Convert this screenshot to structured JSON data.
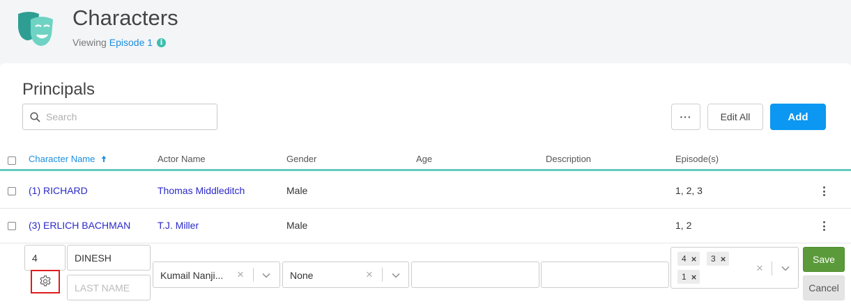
{
  "header": {
    "title": "Characters",
    "viewing_label": "Viewing",
    "episode_link": "Episode 1"
  },
  "section": {
    "title": "Principals"
  },
  "search": {
    "placeholder": "Search",
    "value": ""
  },
  "toolbar": {
    "more_label": "···",
    "edit_all_label": "Edit All",
    "add_label": "Add"
  },
  "table": {
    "columns": [
      {
        "label": "Character Name",
        "sort": "ascending"
      },
      {
        "label": "Actor Name"
      },
      {
        "label": "Gender"
      },
      {
        "label": "Age"
      },
      {
        "label": "Description"
      },
      {
        "label": "Episode(s)"
      }
    ],
    "rows": [
      {
        "character": "(1) RICHARD",
        "actor": "Thomas Middleditch",
        "gender": "Male",
        "age": "",
        "description": "",
        "episodes": "1, 2, 3"
      },
      {
        "character": "(3) ERLICH BACHMAN",
        "actor": "T.J. Miller",
        "gender": "Male",
        "age": "",
        "description": "",
        "episodes": "1, 2"
      }
    ]
  },
  "edit_row": {
    "number_value": "4",
    "first_name_value": "DINESH",
    "last_name_placeholder": "LAST NAME",
    "actor_value": "Kumail Nanji...",
    "gender_value": "None",
    "age_value": "",
    "description_value": "",
    "episode_tags": [
      "4",
      "3",
      "1"
    ],
    "tag_remove_glyph": "×",
    "clear_glyph": "×",
    "save_label": "Save",
    "cancel_label": "Cancel"
  },
  "colors": {
    "accent_teal": "#64c7bf",
    "link_blue": "#1a8fe0",
    "add_button": "#0b97f2",
    "save_button": "#5b9a3a",
    "highlight_box": "#e01b1b"
  }
}
